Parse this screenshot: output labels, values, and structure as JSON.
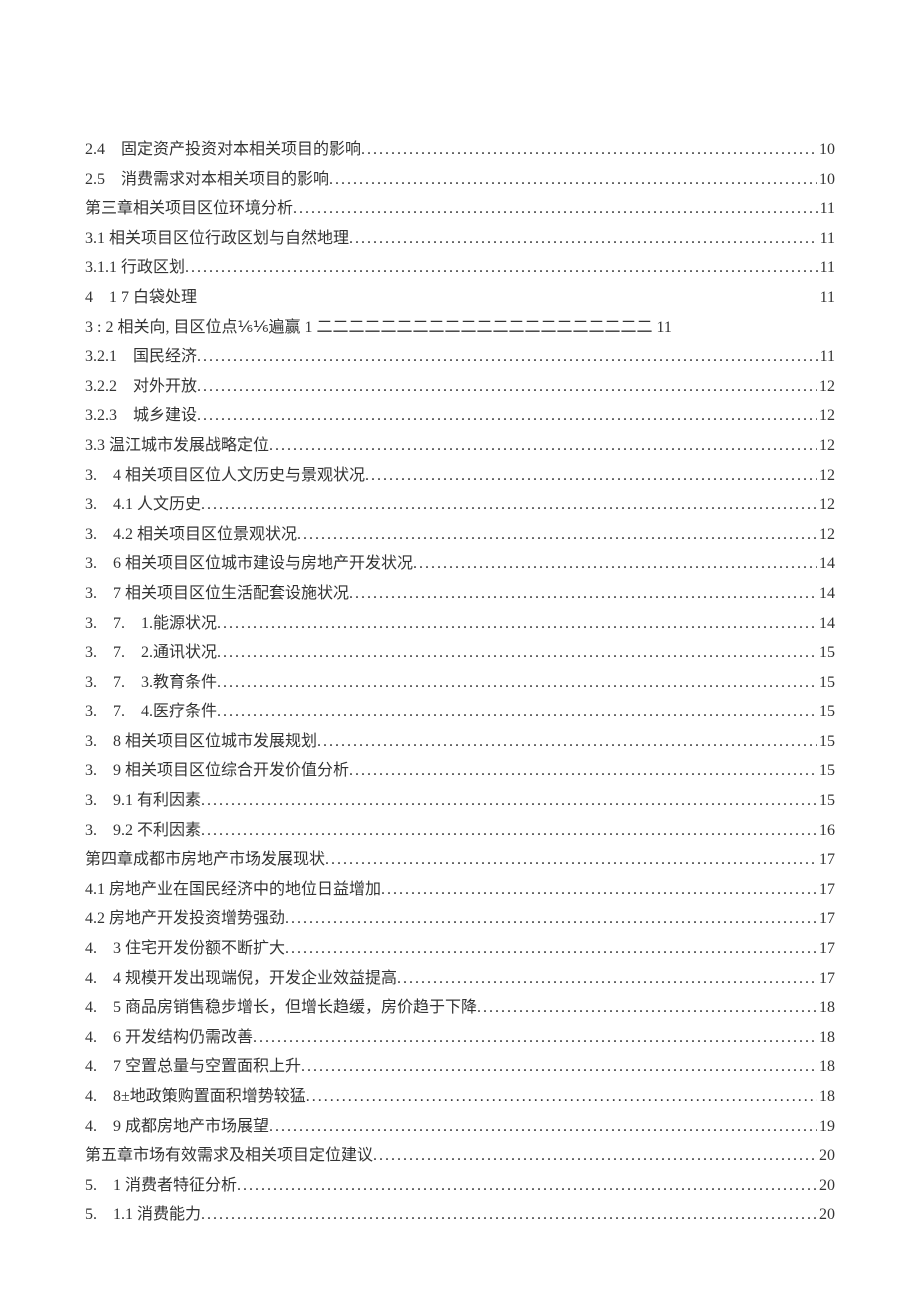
{
  "toc": [
    {
      "text": "2.4　固定资产投资对本相关项目的影响 ",
      "page": " 10",
      "style": "dots"
    },
    {
      "text": "2.5　消费需求对本相关项目的影响 ",
      "page": " 10",
      "style": "dots"
    },
    {
      "text": "第三章相关项目区位环境分析 ",
      "page": " 11",
      "style": "dots"
    },
    {
      "text": "3.1 相关项目区位行政区划与自然地理 ",
      "page": " 11",
      "style": "dots"
    },
    {
      "text": "3.1.1 行政区划 ",
      "page": " 11",
      "style": "dots"
    },
    {
      "text": "4　1 7 白袋处理",
      "page": "11",
      "style": "special"
    },
    {
      "text": "3 : 2 相关向, 目区位点⅙⅙遍赢 1 二二二二二二二二二二二二二二二二二二二二二 11",
      "page": "",
      "style": "nodots"
    },
    {
      "text": "3.2.1　国民经济 ",
      "page": " 11",
      "style": "dots"
    },
    {
      "text": "3.2.2　对外开放 ",
      "page": " 12",
      "style": "dots"
    },
    {
      "text": "3.2.3　城乡建设 ",
      "page": " 12",
      "style": "dots"
    },
    {
      "text": "3.3 温江城市发展战略定位",
      "page": " 12",
      "style": "dots"
    },
    {
      "text": "3.　4 相关项目区位人文历史与景观状况 ",
      "page": " 12",
      "style": "dots"
    },
    {
      "text": "3.　4.1 人文历史 ",
      "page": " 12",
      "style": "dots"
    },
    {
      "text": "3.　4.2 相关项目区位景观状况 ",
      "page": " 12",
      "style": "dots"
    },
    {
      "text": "3.　6 相关项目区位城市建设与房地产开发状况 ",
      "page": " 14",
      "style": "dots"
    },
    {
      "text": "3.　7 相关项目区位生活配套设施状况 ",
      "page": " 14",
      "style": "dots"
    },
    {
      "text": "3.　7.　1.能源状况 ",
      "page": " 14",
      "style": "dots"
    },
    {
      "text": "3.　7.　2.通讯状况 ",
      "page": " 15",
      "style": "dots"
    },
    {
      "text": "3.　7.　3.教育条件 ",
      "page": " 15",
      "style": "dots"
    },
    {
      "text": "3.　7.　4.医疗条件 ",
      "page": " 15",
      "style": "dots"
    },
    {
      "text": "3.　8 相关项目区位城市发展规划 ",
      "page": " 15",
      "style": "dots"
    },
    {
      "text": "3.　9 相关项目区位综合开发价值分析 ",
      "page": " 15",
      "style": "dots"
    },
    {
      "text": "3.　9.1 有利因素 ",
      "page": " 15",
      "style": "dots"
    },
    {
      "text": "3.　9.2 不利因素 ",
      "page": " 16",
      "style": "dots"
    },
    {
      "text": "第四章成都市房地产市场发展现状",
      "page": " 17",
      "style": "dots"
    },
    {
      "text": "4.1 房地产业在国民经济中的地位日益增加",
      "page": " 17",
      "style": "dots"
    },
    {
      "text": "4.2 房地产开发投资增势强劲",
      "page": " 17",
      "style": "dots"
    },
    {
      "text": "4.　3 住宅开发份额不断扩大 ",
      "page": " 17",
      "style": "dots"
    },
    {
      "text": "4.　4 规模开发出现端倪，开发企业效益提高 ",
      "page": " 17",
      "style": "dots"
    },
    {
      "text": "4.　5 商品房销售稳步增长，但增长趋缓，房价趋于下降 ",
      "page": " 18",
      "style": "dots"
    },
    {
      "text": "4.　6 开发结构仍需改善 ",
      "page": " 18",
      "style": "dots"
    },
    {
      "text": "4.　7 空置总量与空置面积上升 ",
      "page": " 18",
      "style": "dots"
    },
    {
      "text": "4.　8±地政策购置面积增势较猛",
      "page": " 18",
      "style": "dots"
    },
    {
      "text": "4.　9 成都房地产市场展望 ",
      "page": " 19",
      "style": "dots"
    },
    {
      "text": "第五章市场有效需求及相关项目定位建议",
      "page": " 20",
      "style": "dots"
    },
    {
      "text": "5.　1 消费者特征分析 ",
      "page": " 20",
      "style": "dots"
    },
    {
      "text": "5.　1.1 消费能力 ",
      "page": " 20",
      "style": "dots"
    }
  ]
}
